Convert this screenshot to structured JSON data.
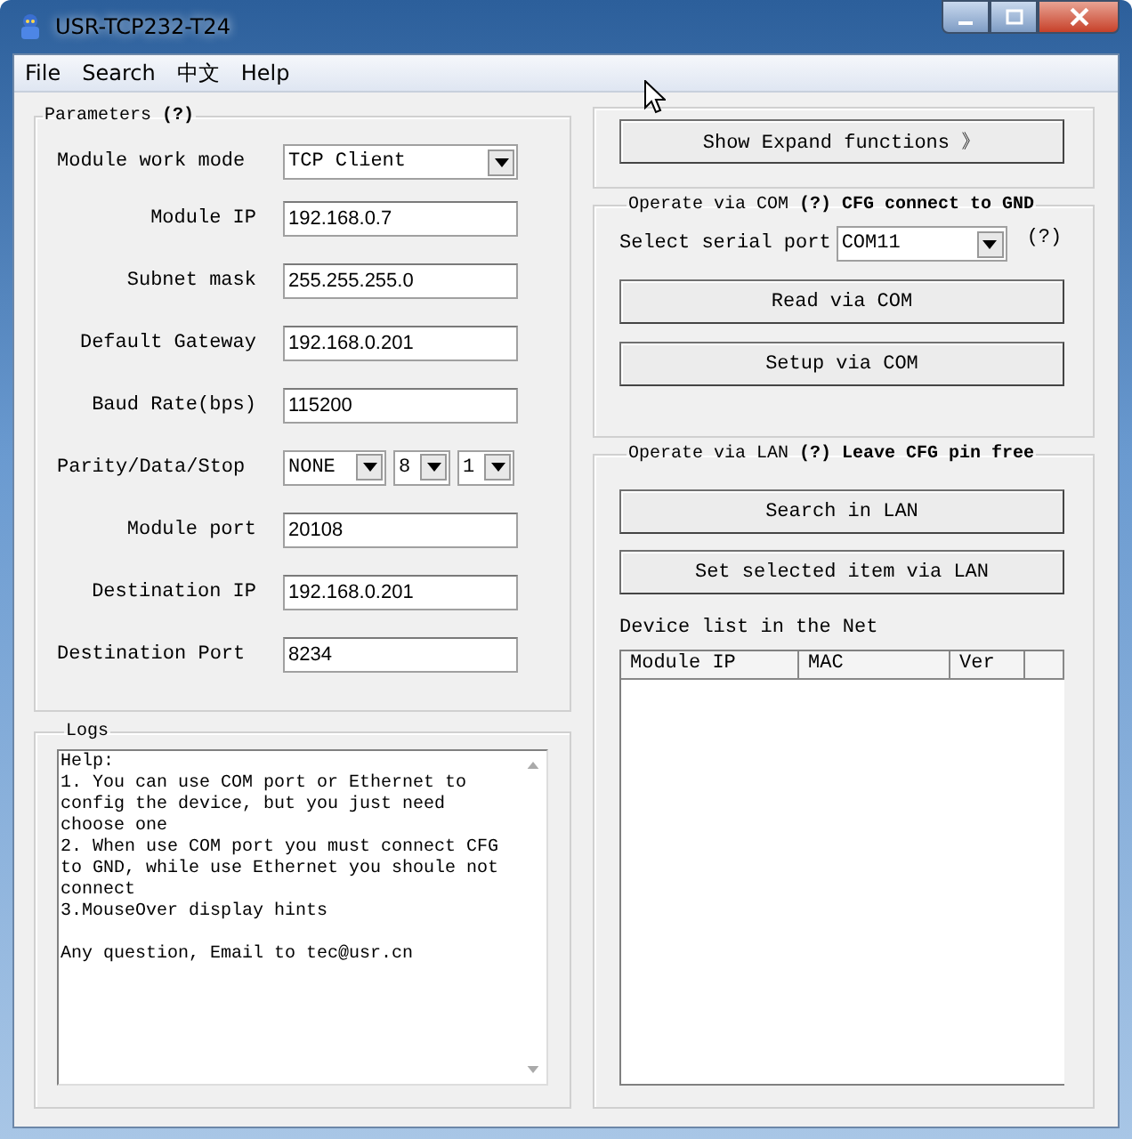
{
  "window": {
    "title": "USR-TCP232-T24"
  },
  "menu": [
    "File",
    "Search",
    "中文",
    "Help"
  ],
  "parameters": {
    "title": "Parameters",
    "hint": "(?)",
    "rows": [
      {
        "label": "Module work mode",
        "kind": "select",
        "values": [
          "TCP Client"
        ]
      },
      {
        "label": "Module IP",
        "kind": "text",
        "value": "192.168.0.7"
      },
      {
        "label": "Subnet mask",
        "kind": "text",
        "value": "255.255.255.0"
      },
      {
        "label": "Default Gateway",
        "kind": "text",
        "value": "192.168.0.201"
      },
      {
        "label": "Baud Rate(bps)",
        "kind": "text",
        "value": "115200"
      },
      {
        "label": "Parity/Data/Stop",
        "kind": "select",
        "values": [
          "NONE",
          "8",
          "1"
        ]
      },
      {
        "label": "Module port",
        "kind": "text",
        "value": "20108"
      },
      {
        "label": "Destination IP",
        "kind": "text",
        "value": "192.168.0.201"
      },
      {
        "label": "Destination Port",
        "kind": "text",
        "value": "8234"
      }
    ]
  },
  "logs": {
    "title": "Logs",
    "paragraphs": [
      {
        "lines": [
          "Help:",
          "1. You can use COM port or Ethernet to",
          "config the device, but you just need",
          "choose one",
          "2. When use COM port you must connect CFG",
          "to GND, while use Ethernet you shoule not",
          "connect",
          "3.MouseOver display hints"
        ]
      },
      {
        "lines": [
          "Any question, Email to tec@usr.cn"
        ]
      }
    ]
  },
  "expand_button": "Show Expand functions 》",
  "com": {
    "title": "Operate via COM",
    "hint": "(?) CFG connect to GND",
    "port_label": "Select serial port",
    "port": "COM11",
    "port_hint": "(?)",
    "buttons": [
      "Read via COM",
      "Setup via COM"
    ]
  },
  "lan": {
    "title": "Operate via LAN",
    "hint": "(?) Leave CFG pin free",
    "buttons": [
      "Search in LAN",
      "Set selected item via LAN"
    ],
    "list_label": "Device list in the Net",
    "columns": [
      "Module IP",
      "MAC",
      "Ver"
    ]
  }
}
